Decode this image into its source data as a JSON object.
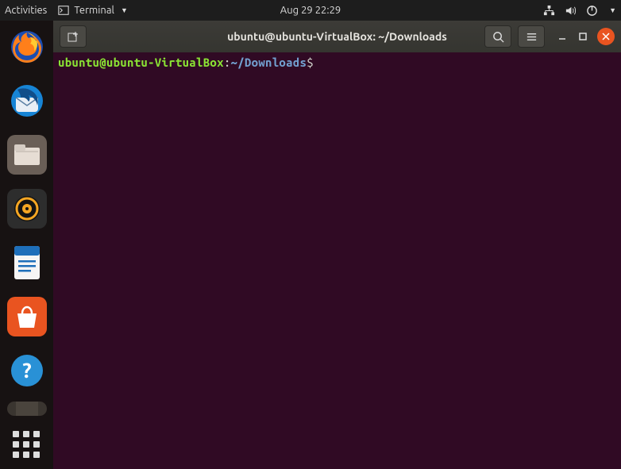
{
  "topbar": {
    "activities": "Activities",
    "app_label": "Terminal",
    "datetime": "Aug 29  22:29"
  },
  "titlebar": {
    "title": "ubuntu@ubuntu-VirtualBox: ~/Downloads"
  },
  "terminal": {
    "prompt_userhost": "ubuntu@ubuntu-VirtualBox",
    "prompt_colon": ":",
    "prompt_path": "~/Downloads",
    "prompt_symbol": "$"
  },
  "dock": {
    "items": [
      "firefox",
      "thunderbird",
      "files",
      "rhythmbox",
      "writer",
      "software",
      "help"
    ]
  }
}
